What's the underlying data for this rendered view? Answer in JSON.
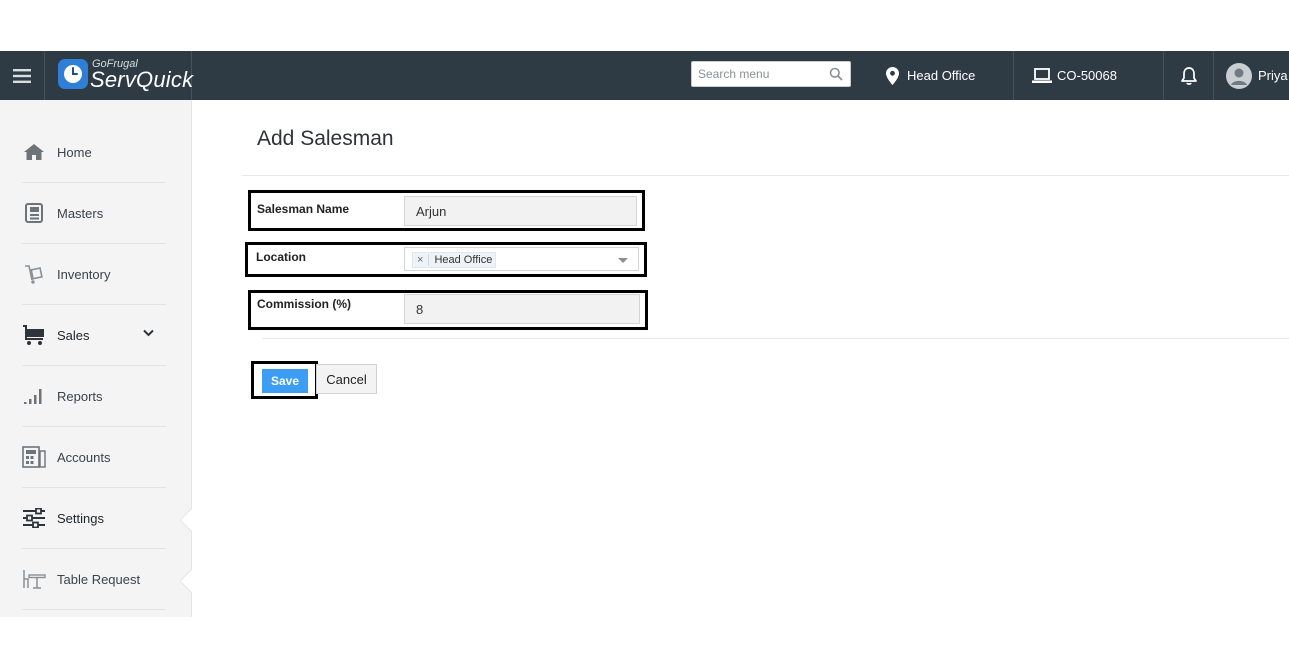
{
  "header": {
    "brand_small": "GoFrugal",
    "brand_name": "ServQuick",
    "search_placeholder": "Search menu",
    "location": "Head Office",
    "terminal": "CO-50068",
    "user": "Priya"
  },
  "sidebar": {
    "items": [
      {
        "label": "Home",
        "icon": "home-icon"
      },
      {
        "label": "Masters",
        "icon": "masters-icon"
      },
      {
        "label": "Inventory",
        "icon": "inventory-icon"
      },
      {
        "label": "Sales",
        "icon": "cart-icon"
      },
      {
        "label": "Reports",
        "icon": "bar-chart-icon"
      },
      {
        "label": "Accounts",
        "icon": "accounts-icon"
      },
      {
        "label": "Settings",
        "icon": "sliders-icon"
      },
      {
        "label": "Table Request",
        "icon": "table-icon"
      }
    ]
  },
  "main": {
    "title": "Add Salesman",
    "form": {
      "name_label": "Salesman Name",
      "name_value": "Arjun",
      "location_label": "Location",
      "location_chip": "Head Office",
      "chip_remove": "×",
      "commission_label": "Commission (%)",
      "commission_value": "8"
    },
    "save_label": "Save",
    "cancel_label": "Cancel"
  },
  "colors": {
    "topbar": "#2f3b44",
    "primary_button": "#3d9df3",
    "sidebar_bg": "#f4f4f5"
  }
}
